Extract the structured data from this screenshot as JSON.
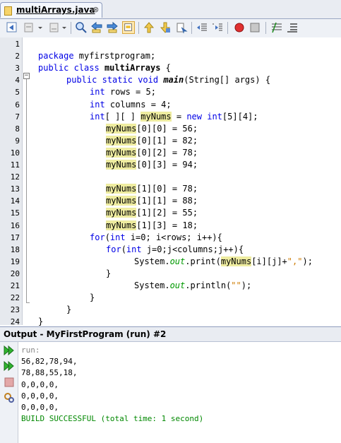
{
  "editor": {
    "tab_title": "multiArrays.java",
    "close_glyph": "⊗"
  },
  "code_lines": [
    {
      "n": "1",
      "parts": []
    },
    {
      "n": "2",
      "indent": 0,
      "parts": [
        {
          "t": "package",
          "c": "kw"
        },
        {
          "t": " myfirstprogram;"
        }
      ]
    },
    {
      "n": "3",
      "indent": 0,
      "parts": [
        {
          "t": "public",
          "c": "kw"
        },
        {
          "t": " "
        },
        {
          "t": "class",
          "c": "kw"
        },
        {
          "t": " "
        },
        {
          "t": "multiArrays",
          "c": "b"
        },
        {
          "t": " {"
        }
      ]
    },
    {
      "n": "4",
      "indent": 1,
      "parts": [
        {
          "t": "public",
          "c": "kw"
        },
        {
          "t": " "
        },
        {
          "t": "static",
          "c": "kw"
        },
        {
          "t": " "
        },
        {
          "t": "void",
          "c": "kw"
        },
        {
          "t": " "
        },
        {
          "t": "main",
          "c": "bi"
        },
        {
          "t": "(String[] args) {"
        }
      ]
    },
    {
      "n": "5",
      "indent": 2,
      "parts": [
        {
          "t": "int",
          "c": "kw"
        },
        {
          "t": " rows = 5;"
        }
      ]
    },
    {
      "n": "6",
      "indent": 2,
      "parts": [
        {
          "t": "int",
          "c": "kw"
        },
        {
          "t": " columns = 4;"
        }
      ]
    },
    {
      "n": "7",
      "indent": 2,
      "parts": [
        {
          "t": "int",
          "c": "kw"
        },
        {
          "t": "[ ][ ] "
        },
        {
          "t": "myNums",
          "c": "hl"
        },
        {
          "t": " = "
        },
        {
          "t": "new",
          "c": "kw"
        },
        {
          "t": " "
        },
        {
          "t": "int",
          "c": "kw"
        },
        {
          "t": "[5][4];"
        }
      ]
    },
    {
      "n": "8",
      "indent": 3,
      "parts": [
        {
          "t": "myNums",
          "c": "hl"
        },
        {
          "t": "[0][0] = 56;"
        }
      ]
    },
    {
      "n": "9",
      "indent": 3,
      "parts": [
        {
          "t": "myNums",
          "c": "hl"
        },
        {
          "t": "[0][1] = 82;"
        }
      ]
    },
    {
      "n": "10",
      "indent": 3,
      "parts": [
        {
          "t": "myNums",
          "c": "hl"
        },
        {
          "t": "[0][2] = 78;"
        }
      ]
    },
    {
      "n": "11",
      "indent": 3,
      "parts": [
        {
          "t": "myNums",
          "c": "hl"
        },
        {
          "t": "[0][3] = 94;"
        }
      ]
    },
    {
      "n": "12",
      "parts": []
    },
    {
      "n": "13",
      "indent": 3,
      "parts": [
        {
          "t": "myNums",
          "c": "hl"
        },
        {
          "t": "[1][0] = 78;"
        }
      ]
    },
    {
      "n": "14",
      "indent": 3,
      "parts": [
        {
          "t": "myNums",
          "c": "hl"
        },
        {
          "t": "[1][1] = 88;"
        }
      ]
    },
    {
      "n": "15",
      "indent": 3,
      "parts": [
        {
          "t": "myNums",
          "c": "hl"
        },
        {
          "t": "[1][2] = 55;"
        }
      ]
    },
    {
      "n": "16",
      "indent": 3,
      "parts": [
        {
          "t": "myNums",
          "c": "hl"
        },
        {
          "t": "[1][3] = 18;"
        }
      ]
    },
    {
      "n": "17",
      "indent": 2,
      "parts": [
        {
          "t": "for",
          "c": "kw"
        },
        {
          "t": "("
        },
        {
          "t": "int",
          "c": "kw"
        },
        {
          "t": " i=0; i<rows; i++){"
        }
      ]
    },
    {
      "n": "18",
      "indent": 3,
      "parts": [
        {
          "t": "for",
          "c": "kw"
        },
        {
          "t": "("
        },
        {
          "t": "int",
          "c": "kw"
        },
        {
          "t": " j=0;j<columns;j++){"
        }
      ]
    },
    {
      "n": "19",
      "indent": 4,
      "parts": [
        {
          "t": "System."
        },
        {
          "t": "out",
          "c": "fi"
        },
        {
          "t": ".print("
        },
        {
          "t": "myNums",
          "c": "hl"
        },
        {
          "t": "[i][j]+"
        },
        {
          "t": "\",\"",
          "c": "str"
        },
        {
          "t": ");"
        }
      ]
    },
    {
      "n": "20",
      "indent": 3,
      "parts": [
        {
          "t": "}"
        }
      ]
    },
    {
      "n": "21",
      "indent": 4,
      "parts": [
        {
          "t": "System."
        },
        {
          "t": "out",
          "c": "fi"
        },
        {
          "t": ".println("
        },
        {
          "t": "\"\"",
          "c": "str"
        },
        {
          "t": ");"
        }
      ]
    },
    {
      "n": "22",
      "indent": 2,
      "parts": [
        {
          "t": "}"
        }
      ]
    },
    {
      "n": "23",
      "indent": 1,
      "parts": [
        {
          "t": "}"
        }
      ]
    },
    {
      "n": "24",
      "indent": 0,
      "parts": [
        {
          "t": "}"
        }
      ]
    }
  ],
  "output": {
    "title": "Output - MyFirstProgram (run) #2",
    "lines": [
      {
        "t": "run:",
        "c": "gray"
      },
      {
        "t": "56,82,78,94,"
      },
      {
        "t": "78,88,55,18,"
      },
      {
        "t": "0,0,0,0,"
      },
      {
        "t": "0,0,0,0,"
      },
      {
        "t": "0,0,0,0,"
      },
      {
        "t": "BUILD SUCCESSFUL (total time: 1 second)",
        "c": "green"
      }
    ]
  },
  "colors": {
    "keyword": "#0000e6",
    "highlight": "#eeeca0",
    "string": "#ce7b00",
    "field": "#009900",
    "success": "#008800"
  }
}
